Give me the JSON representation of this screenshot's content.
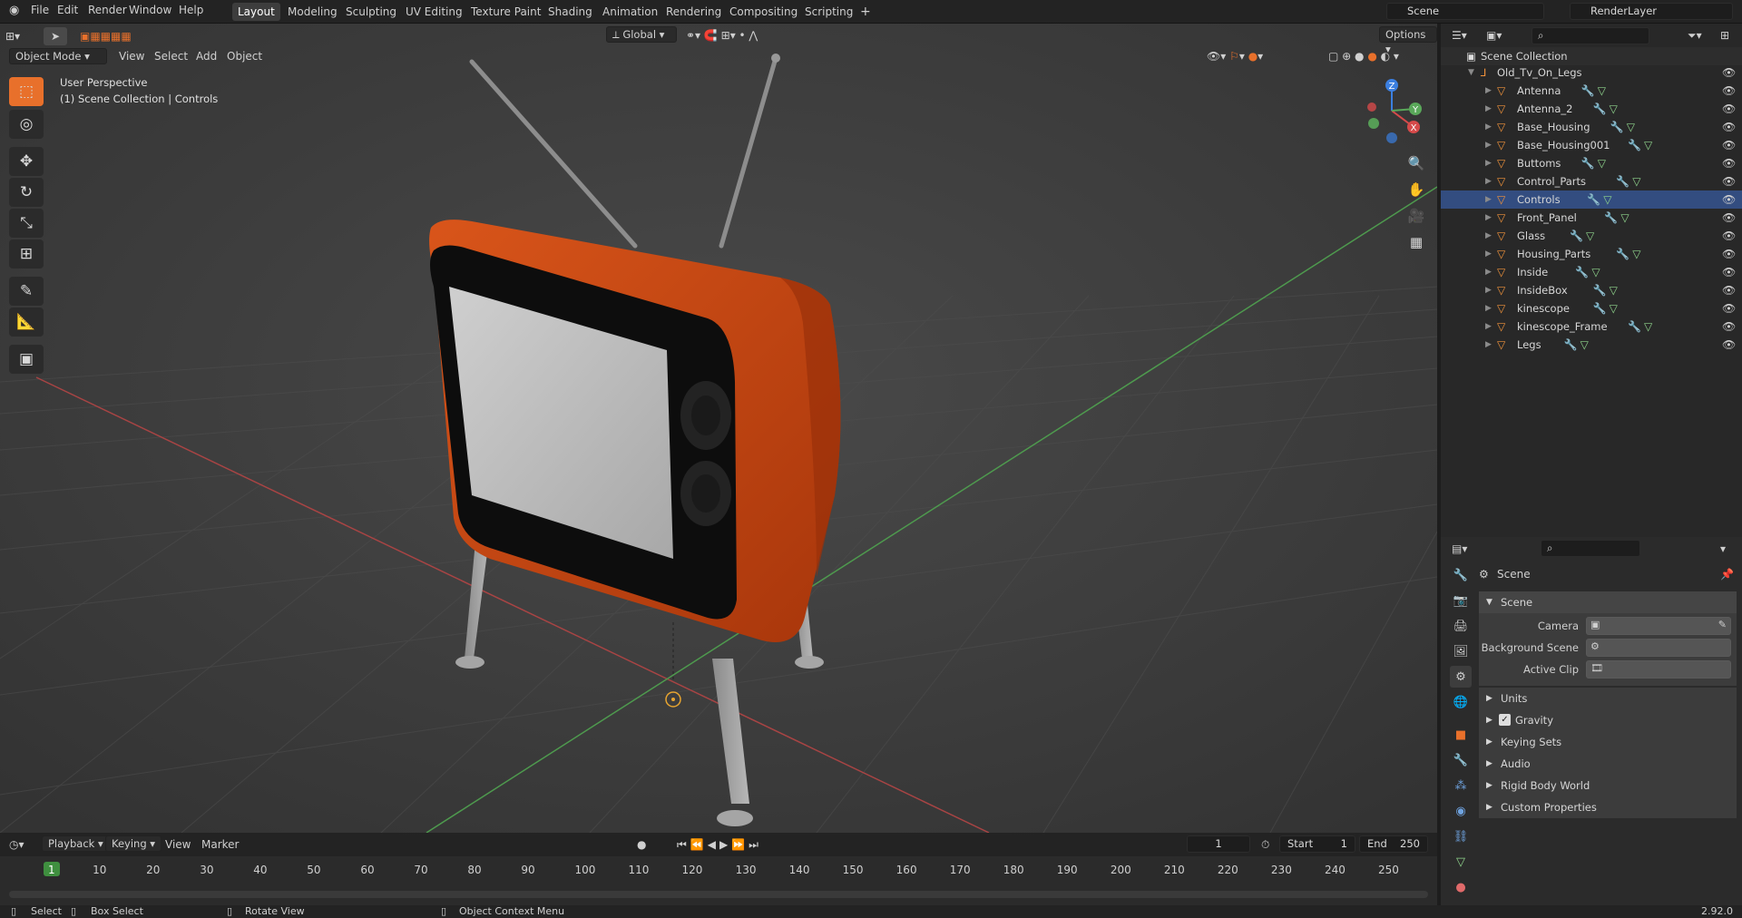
{
  "app": {
    "version": "2.92.0"
  },
  "menus": [
    "File",
    "Edit",
    "Render",
    "Window",
    "Help"
  ],
  "workspace_tabs": [
    "Layout",
    "Modeling",
    "Sculpting",
    "UV Editing",
    "Texture Paint",
    "Shading",
    "Animation",
    "Rendering",
    "Compositing",
    "Scripting"
  ],
  "active_tab": "Layout",
  "scene_selector": {
    "value": "Scene"
  },
  "renderlayer_selector": {
    "value": "RenderLayer"
  },
  "viewport": {
    "mode": "Object Mode",
    "menu": [
      "View",
      "Select",
      "Add",
      "Object"
    ],
    "transform_orientation": "Global",
    "options_label": "Options",
    "perspective_label": "User Perspective",
    "collection_label": "(1) Scene Collection | Controls",
    "gizmo_axes": {
      "x": "X",
      "y": "Y",
      "z": "Z"
    }
  },
  "outliner": {
    "root": "Scene Collection",
    "collection": "Old_Tv_On_Legs",
    "items": [
      "Antenna",
      "Antenna_2",
      "Base_Housing",
      "Base_Housing001",
      "Buttoms",
      "Control_Parts",
      "Controls",
      "Front_Panel",
      "Glass",
      "Housing_Parts",
      "Inside",
      "InsideBox",
      "kinescope",
      "kinescope_Frame",
      "Legs"
    ],
    "active_item": "Controls"
  },
  "properties": {
    "context_title": "Scene",
    "panel_title": "Scene",
    "fields": [
      {
        "label": "Camera",
        "value": ""
      },
      {
        "label": "Background Scene",
        "value": ""
      },
      {
        "label": "Active Clip",
        "value": ""
      }
    ],
    "subpanels": [
      "Units",
      "Gravity",
      "Keying Sets",
      "Audio",
      "Rigid Body World",
      "Custom Properties"
    ],
    "gravity_checked": true
  },
  "timeline": {
    "menus": [
      "Playback",
      "Keying",
      "View",
      "Marker"
    ],
    "current_frame": "1",
    "start_label": "Start",
    "start": "1",
    "end_label": "End",
    "end": "250",
    "ticks": [
      "1",
      "10",
      "20",
      "30",
      "40",
      "50",
      "60",
      "70",
      "80",
      "90",
      "100",
      "110",
      "120",
      "130",
      "140",
      "150",
      "160",
      "170",
      "180",
      "190",
      "200",
      "210",
      "220",
      "230",
      "240",
      "250"
    ]
  },
  "statusbar": {
    "select": "Select",
    "box_select": "Box Select",
    "rotate_view": "Rotate View",
    "context_menu": "Object Context Menu",
    "version": "2.92.0"
  },
  "colors": {
    "accent": "#e8702b",
    "tv_body": "#c2410c",
    "axis_x": "#d64a4a",
    "axis_y": "#5aa85a",
    "axis_z": "#3b7fe0"
  }
}
